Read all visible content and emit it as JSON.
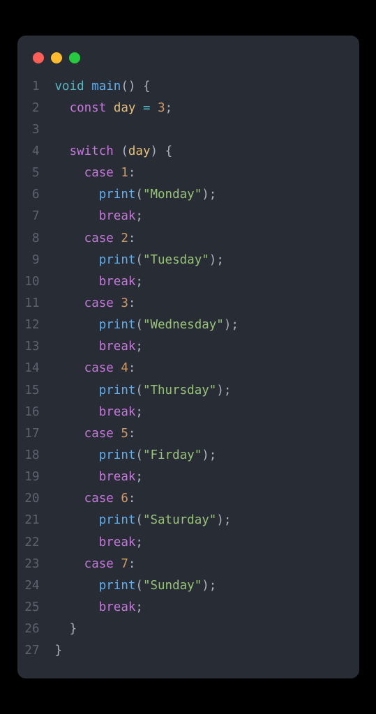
{
  "titlebar": {
    "buttons": [
      "close",
      "minimize",
      "zoom"
    ]
  },
  "code": {
    "lines": [
      {
        "n": 1,
        "indent": 0,
        "tokens": [
          {
            "c": "type",
            "t": "void"
          },
          {
            "c": "plain",
            "t": " "
          },
          {
            "c": "fn",
            "t": "main"
          },
          {
            "c": "punc",
            "t": "() {"
          }
        ]
      },
      {
        "n": 2,
        "indent": 1,
        "tokens": [
          {
            "c": "kw",
            "t": "const"
          },
          {
            "c": "plain",
            "t": " "
          },
          {
            "c": "ident",
            "t": "day"
          },
          {
            "c": "plain",
            "t": " "
          },
          {
            "c": "op",
            "t": "="
          },
          {
            "c": "plain",
            "t": " "
          },
          {
            "c": "num",
            "t": "3"
          },
          {
            "c": "punc",
            "t": ";"
          }
        ]
      },
      {
        "n": 3,
        "indent": 0,
        "tokens": []
      },
      {
        "n": 4,
        "indent": 1,
        "tokens": [
          {
            "c": "kw",
            "t": "switch"
          },
          {
            "c": "plain",
            "t": " "
          },
          {
            "c": "punc",
            "t": "("
          },
          {
            "c": "ident",
            "t": "day"
          },
          {
            "c": "punc",
            "t": ") {"
          }
        ]
      },
      {
        "n": 5,
        "indent": 2,
        "tokens": [
          {
            "c": "kw",
            "t": "case"
          },
          {
            "c": "plain",
            "t": " "
          },
          {
            "c": "num",
            "t": "1"
          },
          {
            "c": "punc",
            "t": ":"
          }
        ]
      },
      {
        "n": 6,
        "indent": 3,
        "tokens": [
          {
            "c": "fn",
            "t": "print"
          },
          {
            "c": "punc",
            "t": "("
          },
          {
            "c": "str",
            "t": "\"Monday\""
          },
          {
            "c": "punc",
            "t": ");"
          }
        ]
      },
      {
        "n": 7,
        "indent": 3,
        "tokens": [
          {
            "c": "kw",
            "t": "break"
          },
          {
            "c": "punc",
            "t": ";"
          }
        ]
      },
      {
        "n": 8,
        "indent": 2,
        "tokens": [
          {
            "c": "kw",
            "t": "case"
          },
          {
            "c": "plain",
            "t": " "
          },
          {
            "c": "num",
            "t": "2"
          },
          {
            "c": "punc",
            "t": ":"
          }
        ]
      },
      {
        "n": 9,
        "indent": 3,
        "tokens": [
          {
            "c": "fn",
            "t": "print"
          },
          {
            "c": "punc",
            "t": "("
          },
          {
            "c": "str",
            "t": "\"Tuesday\""
          },
          {
            "c": "punc",
            "t": ");"
          }
        ]
      },
      {
        "n": 10,
        "indent": 3,
        "tokens": [
          {
            "c": "kw",
            "t": "break"
          },
          {
            "c": "punc",
            "t": ";"
          }
        ]
      },
      {
        "n": 11,
        "indent": 2,
        "tokens": [
          {
            "c": "kw",
            "t": "case"
          },
          {
            "c": "plain",
            "t": " "
          },
          {
            "c": "num",
            "t": "3"
          },
          {
            "c": "punc",
            "t": ":"
          }
        ]
      },
      {
        "n": 12,
        "indent": 3,
        "tokens": [
          {
            "c": "fn",
            "t": "print"
          },
          {
            "c": "punc",
            "t": "("
          },
          {
            "c": "str",
            "t": "\"Wednesday\""
          },
          {
            "c": "punc",
            "t": ");"
          }
        ]
      },
      {
        "n": 13,
        "indent": 3,
        "tokens": [
          {
            "c": "kw",
            "t": "break"
          },
          {
            "c": "punc",
            "t": ";"
          }
        ]
      },
      {
        "n": 14,
        "indent": 2,
        "tokens": [
          {
            "c": "kw",
            "t": "case"
          },
          {
            "c": "plain",
            "t": " "
          },
          {
            "c": "num",
            "t": "4"
          },
          {
            "c": "punc",
            "t": ":"
          }
        ]
      },
      {
        "n": 15,
        "indent": 3,
        "tokens": [
          {
            "c": "fn",
            "t": "print"
          },
          {
            "c": "punc",
            "t": "("
          },
          {
            "c": "str",
            "t": "\"Thursday\""
          },
          {
            "c": "punc",
            "t": ");"
          }
        ]
      },
      {
        "n": 16,
        "indent": 3,
        "tokens": [
          {
            "c": "kw",
            "t": "break"
          },
          {
            "c": "punc",
            "t": ";"
          }
        ]
      },
      {
        "n": 17,
        "indent": 2,
        "tokens": [
          {
            "c": "kw",
            "t": "case"
          },
          {
            "c": "plain",
            "t": " "
          },
          {
            "c": "num",
            "t": "5"
          },
          {
            "c": "punc",
            "t": ":"
          }
        ]
      },
      {
        "n": 18,
        "indent": 3,
        "tokens": [
          {
            "c": "fn",
            "t": "print"
          },
          {
            "c": "punc",
            "t": "("
          },
          {
            "c": "str",
            "t": "\"Firday\""
          },
          {
            "c": "punc",
            "t": ");"
          }
        ]
      },
      {
        "n": 19,
        "indent": 3,
        "tokens": [
          {
            "c": "kw",
            "t": "break"
          },
          {
            "c": "punc",
            "t": ";"
          }
        ]
      },
      {
        "n": 20,
        "indent": 2,
        "tokens": [
          {
            "c": "kw",
            "t": "case"
          },
          {
            "c": "plain",
            "t": " "
          },
          {
            "c": "num",
            "t": "6"
          },
          {
            "c": "punc",
            "t": ":"
          }
        ]
      },
      {
        "n": 21,
        "indent": 3,
        "tokens": [
          {
            "c": "fn",
            "t": "print"
          },
          {
            "c": "punc",
            "t": "("
          },
          {
            "c": "str",
            "t": "\"Saturday\""
          },
          {
            "c": "punc",
            "t": ");"
          }
        ]
      },
      {
        "n": 22,
        "indent": 3,
        "tokens": [
          {
            "c": "kw",
            "t": "break"
          },
          {
            "c": "punc",
            "t": ";"
          }
        ]
      },
      {
        "n": 23,
        "indent": 2,
        "tokens": [
          {
            "c": "kw",
            "t": "case"
          },
          {
            "c": "plain",
            "t": " "
          },
          {
            "c": "num",
            "t": "7"
          },
          {
            "c": "punc",
            "t": ":"
          }
        ]
      },
      {
        "n": 24,
        "indent": 3,
        "tokens": [
          {
            "c": "fn",
            "t": "print"
          },
          {
            "c": "punc",
            "t": "("
          },
          {
            "c": "str",
            "t": "\"Sunday\""
          },
          {
            "c": "punc",
            "t": ");"
          }
        ]
      },
      {
        "n": 25,
        "indent": 3,
        "tokens": [
          {
            "c": "kw",
            "t": "break"
          },
          {
            "c": "punc",
            "t": ";"
          }
        ]
      },
      {
        "n": 26,
        "indent": 1,
        "tokens": [
          {
            "c": "punc",
            "t": "}"
          }
        ]
      },
      {
        "n": 27,
        "indent": 0,
        "tokens": [
          {
            "c": "punc",
            "t": "}"
          }
        ]
      }
    ]
  }
}
